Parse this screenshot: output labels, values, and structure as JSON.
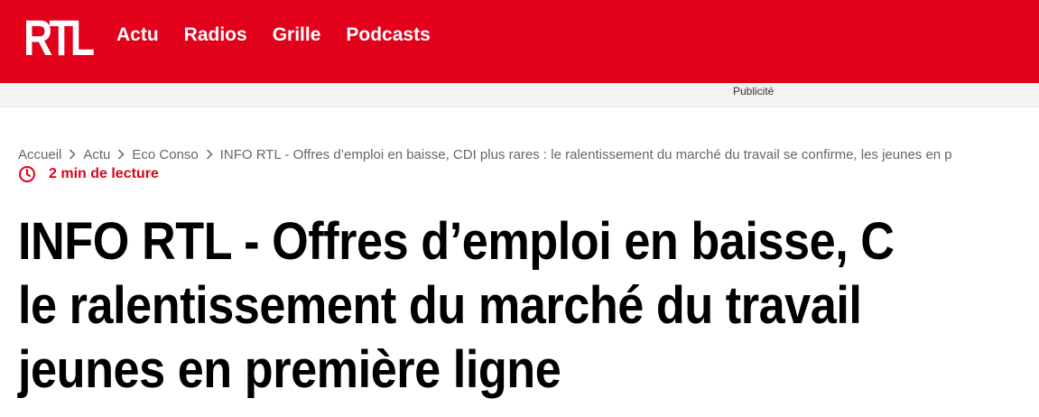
{
  "header": {
    "logo": "RTL",
    "nav": [
      "Actu",
      "Radios",
      "Grille",
      "Podcasts"
    ],
    "brand_color": "#e2001a"
  },
  "ad": {
    "label": "Publicité"
  },
  "breadcrumb": {
    "items": [
      "Accueil",
      "Actu",
      "Eco Conso",
      "INFO RTL - Offres d’emploi en baisse, CDI plus rares : le ralentissement du marché du travail se confirme, les jeunes en p"
    ],
    "separator_icon": "chevron-right-icon"
  },
  "article": {
    "reading_time": "2 min de lecture",
    "reading_icon": "clock-icon",
    "title_lines": [
      "INFO RTL - Offres d’emploi en baisse, C",
      "le ralentissement du marché du travail",
      "jeunes en première ligne"
    ]
  }
}
